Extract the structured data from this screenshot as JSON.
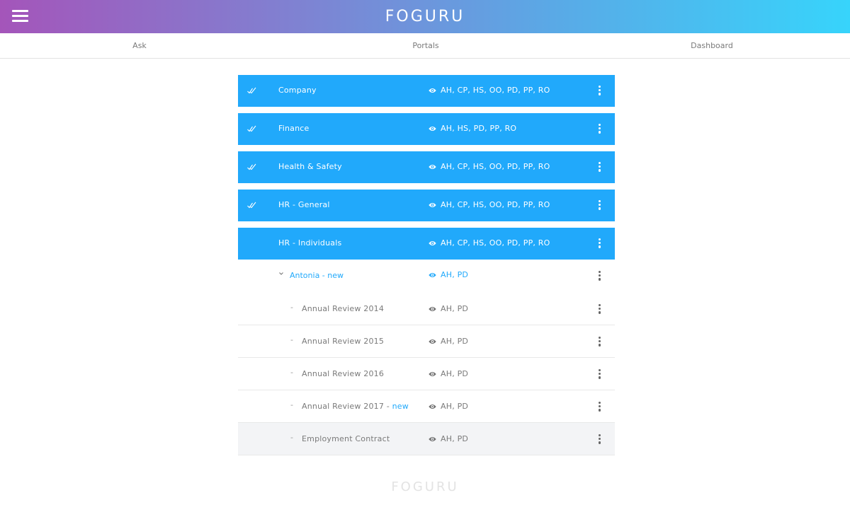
{
  "header": {
    "brand": "FOGURU"
  },
  "tabs": [
    {
      "label": "Ask"
    },
    {
      "label": "Portals"
    },
    {
      "label": "Dashboard"
    }
  ],
  "portals": [
    {
      "label": "Company",
      "access": "AH, CP, HS, OO, PD, PP, RO",
      "checked": true
    },
    {
      "label": "Finance",
      "access": "AH, HS, PD, PP, RO",
      "checked": true
    },
    {
      "label": "Health & Safety",
      "access": "AH, CP, HS, OO, PD, PP, RO",
      "checked": true
    },
    {
      "label": "HR - General",
      "access": "AH, CP, HS, OO, PD, PP, RO",
      "checked": true
    },
    {
      "label": "HR - Individuals",
      "access": "AH, CP, HS, OO, PD, PP, RO",
      "checked": false
    }
  ],
  "folder": {
    "label": "Antonia - new",
    "access": "AH, PD"
  },
  "documents": [
    {
      "label": "Annual Review 2014",
      "new_tag": "",
      "access": "AH, PD"
    },
    {
      "label": "Annual Review 2015",
      "new_tag": "",
      "access": "AH, PD"
    },
    {
      "label": "Annual Review 2016",
      "new_tag": "",
      "access": "AH, PD"
    },
    {
      "label": "Annual Review 2017 - ",
      "new_tag": "new",
      "access": "AH, PD"
    },
    {
      "label": "Employment Contract",
      "new_tag": "",
      "access": "AH, PD"
    }
  ],
  "dash_symbol": "-",
  "footer": {
    "brand": "FOGURU"
  },
  "colors": {
    "accent": "#21a9fb",
    "header_start": "#a455ba",
    "header_end": "#37d4fb"
  }
}
